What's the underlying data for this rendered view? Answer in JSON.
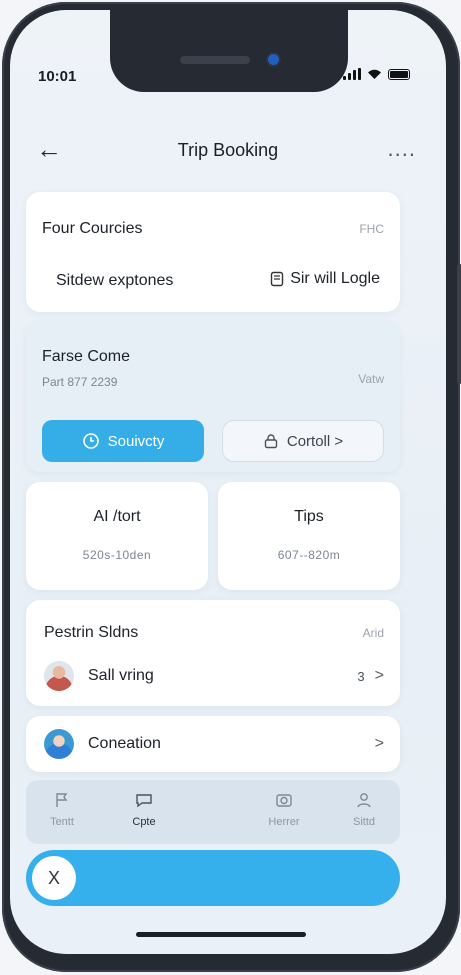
{
  "status": {
    "time": "10:01"
  },
  "nav": {
    "title": "Trip Booking",
    "back_icon": "arrow-left-icon",
    "more": "...."
  },
  "card1": {
    "title": "Four Courcies",
    "right": "FHC",
    "option1": "Sitdew exptones",
    "option2": "Sir will Logle"
  },
  "card2": {
    "title": "Farse Come",
    "subtitle": "Part 877 2239",
    "right": "Vatw",
    "primary_label": "Souivcty",
    "secondary_label": "Cortoll >"
  },
  "stats": [
    {
      "title": "AI /tort",
      "value": "520s-10den"
    },
    {
      "title": "Tips",
      "value": "607--820m"
    }
  ],
  "card5": {
    "title": "Pestrin Sldns",
    "right": "Arid",
    "row_label": "Sall vring",
    "row_meta": "3",
    "row_chevron": ">"
  },
  "card6": {
    "row_label": "Coneation",
    "row_chevron": ">"
  },
  "tabs": [
    {
      "label": "Tentt",
      "icon": "flag-icon"
    },
    {
      "label": "Cpte",
      "icon": "chat-icon"
    },
    {
      "label": "Herrer",
      "icon": "camera-icon"
    },
    {
      "label": "Sittd",
      "icon": "user-icon"
    }
  ],
  "cta": {
    "close_label": "X"
  },
  "colors": {
    "accent": "#35aee8",
    "background": "#eef3f8"
  }
}
